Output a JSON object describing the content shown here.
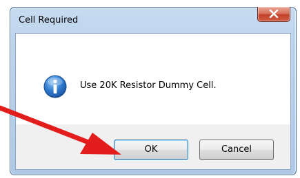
{
  "dialog": {
    "title": "Cell Required",
    "message": "Use 20K Resistor Dummy Cell.",
    "icon": "info-icon",
    "buttons": {
      "ok_label": "OK",
      "cancel_label": "Cancel"
    },
    "close_icon": "close-icon"
  },
  "annotation": {
    "icon": "red-arrow-icon",
    "color": "#e31c1c"
  }
}
